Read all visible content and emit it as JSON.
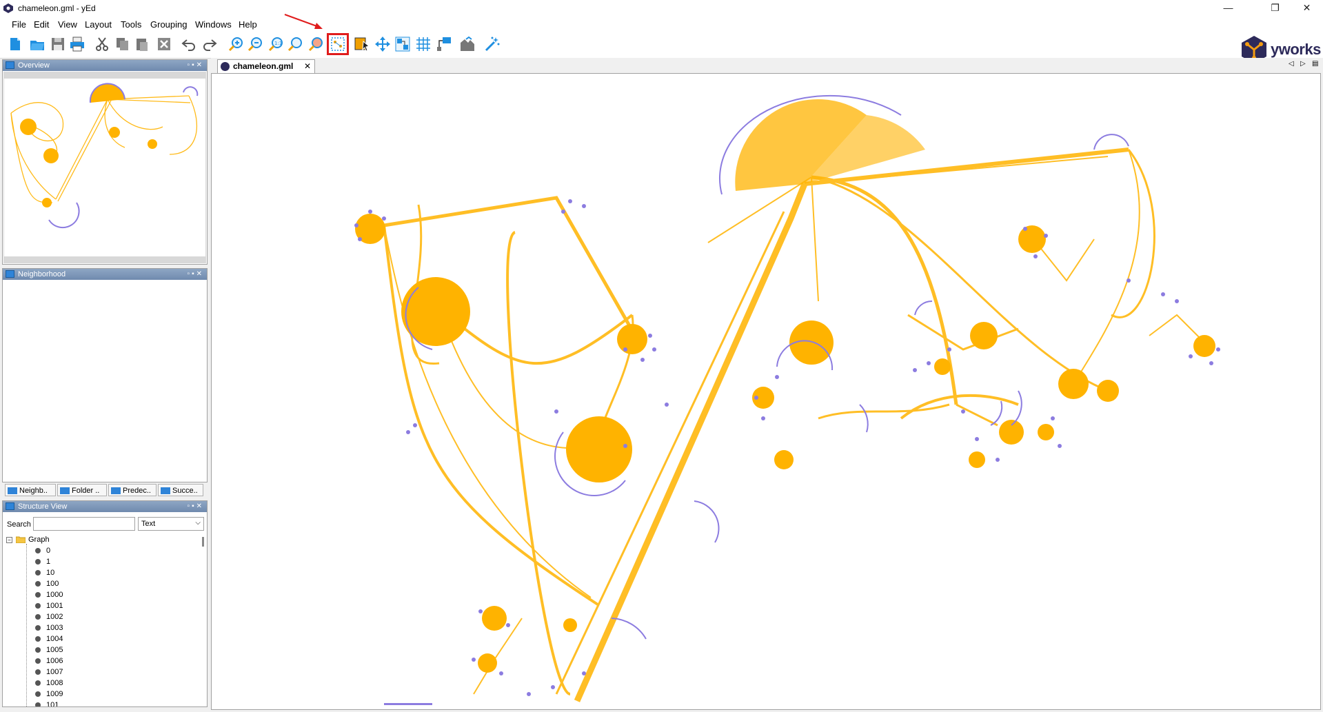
{
  "window": {
    "title": "chameleon.gml - yEd",
    "controls": [
      "—",
      "❐",
      "✕"
    ]
  },
  "menu": [
    "File",
    "Edit",
    "View",
    "Layout",
    "Tools",
    "Grouping",
    "Windows",
    "Help"
  ],
  "toolbar": {
    "icons": [
      "new-document-icon",
      "open-icon",
      "save-icon",
      "print-icon",
      "cut-icon",
      "copy-icon",
      "paste-icon",
      "delete-icon",
      "undo-icon",
      "redo-icon",
      "zoom-in-icon",
      "zoom-out-icon",
      "zoom-100-icon",
      "zoom-area-icon",
      "zoom-selection-icon",
      "fit-content-icon",
      "edit-mode-icon",
      "navigate-icon",
      "resize-icon",
      "grid-icon",
      "orthogonal-edges-icon",
      "snapping-icon",
      "magic-icon"
    ],
    "highlighted": "fit-content-icon"
  },
  "brand": {
    "name": "yworks"
  },
  "colors": {
    "edge": "#ffb300",
    "node": "#8c7ce0",
    "highlight": "#e01c1c"
  },
  "panels": {
    "overview": {
      "title": "Overview"
    },
    "neighborhood": {
      "title": "Neighborhood",
      "tabs": [
        "Neighb..",
        "Folder ..",
        "Predec..",
        "Succe.."
      ]
    },
    "structure": {
      "title": "Structure View",
      "search_label": "Search",
      "search_value": "",
      "mode": "Text",
      "root": "Graph",
      "nodes": [
        "0",
        "1",
        "10",
        "100",
        "1000",
        "1001",
        "1002",
        "1003",
        "1004",
        "1005",
        "1006",
        "1007",
        "1008",
        "1009",
        "101"
      ]
    }
  },
  "document": {
    "tab": "chameleon.gml"
  }
}
